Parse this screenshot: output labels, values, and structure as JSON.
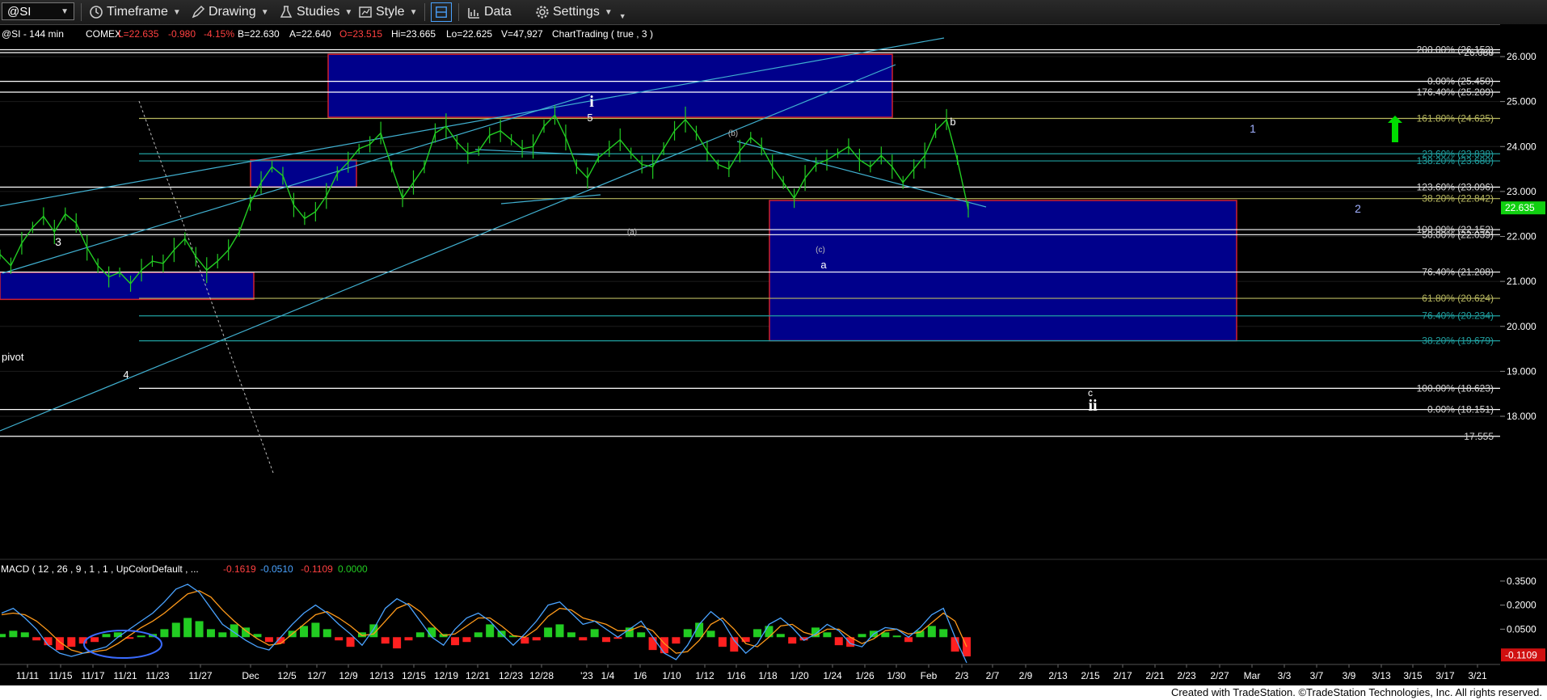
{
  "toolbar": {
    "symbol": "@SI",
    "timeframe": "Timeframe",
    "drawing": "Drawing",
    "studies": "Studies",
    "style": "Style",
    "data": "Data",
    "settings": "Settings"
  },
  "header_line": {
    "symbol": "@SI - 144 min",
    "exchange": "COMEX",
    "last": "L=22.635",
    "change": "-0.980",
    "pct": "-4.15%",
    "bid": "B=22.630",
    "ask": "A=22.640",
    "open": "O=23.515",
    "high": "Hi=23.665",
    "low": "Lo=22.625",
    "volume": "V=47,927",
    "study": "ChartTrading ( true , 3 )"
  },
  "colors": {
    "up": "#22cc22",
    "down": "#ff2020",
    "accent_box": "#00008b",
    "trendline": "#40b0d0",
    "price_tag": "#10d010",
    "macd_tag": "#d01010"
  },
  "chart_data": {
    "type": "line",
    "title": "@SI - 144 min",
    "ylim": [
      17.2,
      26.4
    ],
    "y_ticks": [
      18.0,
      19.0,
      20.0,
      21.0,
      22.0,
      23.0,
      24.0,
      25.0,
      26.0
    ],
    "y_tick_labels": [
      "18.000",
      "19.000",
      "20.000",
      "21.000",
      "22.000",
      "23.000",
      "24.000",
      "25.000",
      "26.000"
    ],
    "last_price_label": "22.635",
    "x_tick_labels": [
      "11/11",
      "11/15",
      "11/17",
      "11/21",
      "11/23",
      "11/27",
      "Dec",
      "12/5",
      "12/7",
      "12/9",
      "12/13",
      "12/15",
      "12/19",
      "12/21",
      "12/23",
      "12/28",
      "'23",
      "1/4",
      "1/6",
      "1/10",
      "1/12",
      "1/16",
      "1/18",
      "1/20",
      "1/24",
      "1/26",
      "1/30",
      "Feb",
      "2/3",
      "2/7",
      "2/9",
      "2/13",
      "2/15",
      "2/17",
      "2/21",
      "2/23",
      "2/27",
      "Mar",
      "3/3",
      "3/7",
      "3/9",
      "3/13",
      "3/15",
      "3/17",
      "3/21"
    ],
    "series": [
      {
        "values": [
          21.6,
          21.35,
          21.85,
          22.2,
          22.45,
          22.1,
          22.5,
          22.3,
          21.75,
          21.35,
          21.1,
          21.2,
          20.95,
          21.25,
          21.45,
          21.4,
          21.7,
          21.95,
          21.55,
          21.25,
          21.45,
          21.7,
          22.1,
          22.75,
          23.2,
          23.55,
          23.35,
          22.7,
          22.4,
          22.55,
          22.9,
          23.4,
          23.65,
          23.95,
          24.05,
          24.3,
          23.55,
          22.85,
          23.2,
          23.55,
          24.3,
          24.45,
          24.1,
          23.85,
          23.9,
          24.25,
          24.35,
          24.15,
          23.95,
          24.0,
          24.45,
          24.7,
          24.2,
          23.55,
          23.3,
          23.75,
          23.95,
          24.15,
          23.85,
          23.6,
          23.55,
          23.95,
          24.35,
          24.6,
          24.3,
          23.9,
          23.6,
          23.5,
          23.9,
          24.2,
          24.0,
          23.55,
          23.2,
          22.85,
          23.3,
          23.6,
          23.7,
          23.85,
          24.0,
          23.7,
          23.55,
          23.8,
          23.55,
          23.2,
          23.5,
          23.8,
          24.35,
          24.6,
          23.7,
          22.6
        ]
      }
    ],
    "boxes": [
      {
        "top": 26.05,
        "bottom": 24.65
      },
      {
        "top": 23.7,
        "bottom": 23.1
      },
      {
        "top": 21.2,
        "bottom": 20.6
      },
      {
        "top": 22.8,
        "bottom": 19.68
      }
    ],
    "fib_levels": [
      {
        "label": "200.00% (26.153)",
        "value": 26.153,
        "color": "#ffffff"
      },
      {
        "label": "26.088",
        "value": 26.088,
        "color": "#ffffff"
      },
      {
        "label": "0.00% (25.450)",
        "value": 25.45,
        "color": "#ffffff"
      },
      {
        "label": "176.40% (25.209)",
        "value": 25.209,
        "color": "#ffffff"
      },
      {
        "label": "161.80% (24.625)",
        "value": 24.625,
        "color": "#b8b860"
      },
      {
        "label": "23.60% (23.838)",
        "value": 23.838,
        "color": "#20a0a0"
      },
      {
        "label": "138.20% (23.680)",
        "value": 23.68,
        "color": "#20a0a0"
      },
      {
        "label": "123.60% (23.096)",
        "value": 23.096,
        "color": "#ffffff"
      },
      {
        "label": "38.20% (22.842)",
        "value": 22.842,
        "color": "#b8b860"
      },
      {
        "label": "100.00% (22.152)",
        "value": 22.152,
        "color": "#ffffff"
      },
      {
        "label": "50.00% (22.039)",
        "value": 22.039,
        "color": "#ffffff"
      },
      {
        "label": "76.40% (21.208)",
        "value": 21.208,
        "color": "#ffffff"
      },
      {
        "label": "61.80% (20.624)",
        "value": 20.624,
        "color": "#b8b860"
      },
      {
        "label": "76.40% (20.234)",
        "value": 20.234,
        "color": "#20a0a0"
      },
      {
        "label": "38.20% (19.679)",
        "value": 19.679,
        "color": "#20a0a0"
      },
      {
        "label": "100.00% (18.623)",
        "value": 18.623,
        "color": "#ffffff"
      },
      {
        "label": "0.00% (18.151)",
        "value": 18.151,
        "color": "#ffffff"
      },
      {
        "label": "17.555",
        "value": 17.555,
        "color": "#ffffff"
      }
    ],
    "wave_labels": [
      {
        "text": "3",
        "kind": "minor"
      },
      {
        "text": "4",
        "kind": "minor"
      },
      {
        "text": "5",
        "kind": "minor"
      },
      {
        "text": "i",
        "kind": "major"
      },
      {
        "text": "(a)",
        "kind": "tiny"
      },
      {
        "text": "(b)",
        "kind": "tiny"
      },
      {
        "text": "(c)",
        "kind": "tiny"
      },
      {
        "text": "a",
        "kind": "minor"
      },
      {
        "text": "b",
        "kind": "minor"
      },
      {
        "text": "c",
        "kind": "minor"
      },
      {
        "text": "ii",
        "kind": "major"
      },
      {
        "text": "1",
        "kind": "blue"
      },
      {
        "text": "2",
        "kind": "blue"
      },
      {
        "text": "pivot",
        "kind": "minor"
      }
    ]
  },
  "macd": {
    "label": "MACD ( 12 , 26 , 9 , 1 , 1 , UpColorDefault , ...",
    "value1": "-0.1619",
    "value2": "-0.0510",
    "value3": "-0.1109",
    "value4": "0.0000",
    "ylim": [
      -0.16,
      0.42
    ],
    "y_ticks": [
      0.35,
      0.2,
      0.05
    ],
    "y_tick_labels": [
      "0.3500",
      "0.2000",
      "0.0500"
    ],
    "last_label": "-0.1109",
    "hist": [
      0.02,
      0.04,
      0.03,
      -0.02,
      -0.05,
      -0.08,
      -0.06,
      -0.04,
      -0.03,
      0.02,
      0.03,
      -0.01,
      0.01,
      0.02,
      0.05,
      0.09,
      0.12,
      0.1,
      0.05,
      0.03,
      0.08,
      0.06,
      0.02,
      -0.03,
      -0.04,
      0.04,
      0.07,
      0.09,
      0.05,
      -0.02,
      -0.06,
      0.03,
      0.08,
      -0.04,
      -0.07,
      -0.02,
      0.03,
      0.06,
      0.02,
      -0.05,
      -0.03,
      0.03,
      0.08,
      0.04,
      0.01,
      -0.04,
      -0.02,
      0.06,
      0.08,
      0.03,
      -0.02,
      0.05,
      -0.03,
      -0.01,
      0.06,
      0.03,
      -0.08,
      -0.1,
      -0.04,
      0.05,
      0.09,
      0.04,
      -0.06,
      -0.09,
      -0.03,
      0.05,
      0.07,
      0.02,
      -0.04,
      -0.02,
      0.06,
      0.03,
      -0.05,
      -0.06,
      0.02,
      0.04,
      0.03,
      0.01,
      -0.03,
      0.04,
      0.07,
      0.05,
      -0.09,
      -0.12
    ],
    "macd_line": [
      0.15,
      0.18,
      0.12,
      0.05,
      -0.05,
      -0.1,
      -0.12,
      -0.1,
      -0.08,
      -0.06,
      0.0,
      0.05,
      0.1,
      0.15,
      0.22,
      0.3,
      0.33,
      0.28,
      0.18,
      0.08,
      0.03,
      -0.02,
      -0.06,
      -0.08,
      0.0,
      0.08,
      0.15,
      0.2,
      0.15,
      0.08,
      0.02,
      -0.05,
      0.05,
      0.18,
      0.24,
      0.2,
      0.1,
      0.0,
      -0.05,
      0.05,
      0.12,
      0.15,
      0.1,
      0.02,
      -0.05,
      0.02,
      0.1,
      0.2,
      0.22,
      0.15,
      0.08,
      0.1,
      0.05,
      0.0,
      0.05,
      0.1,
      0.0,
      -0.1,
      -0.14,
      -0.05,
      0.08,
      0.16,
      0.1,
      -0.02,
      -0.1,
      -0.04,
      0.08,
      0.12,
      0.06,
      -0.02,
      0.02,
      0.08,
      0.04,
      -0.04,
      -0.06,
      0.02,
      0.06,
      0.05,
      0.0,
      0.06,
      0.14,
      0.18,
      0.0,
      -0.16
    ],
    "signal_line": [
      0.14,
      0.15,
      0.14,
      0.1,
      0.04,
      -0.03,
      -0.08,
      -0.1,
      -0.09,
      -0.08,
      -0.04,
      0.01,
      0.06,
      0.1,
      0.15,
      0.21,
      0.27,
      0.29,
      0.25,
      0.17,
      0.1,
      0.04,
      -0.01,
      -0.05,
      -0.04,
      0.02,
      0.08,
      0.14,
      0.16,
      0.12,
      0.07,
      0.01,
      0.02,
      0.1,
      0.18,
      0.21,
      0.16,
      0.08,
      0.01,
      0.02,
      0.07,
      0.12,
      0.12,
      0.07,
      0.01,
      0.0,
      0.05,
      0.13,
      0.18,
      0.17,
      0.12,
      0.1,
      0.08,
      0.04,
      0.04,
      0.07,
      0.04,
      -0.04,
      -0.1,
      -0.09,
      -0.02,
      0.08,
      0.12,
      0.05,
      -0.04,
      -0.06,
      0.0,
      0.07,
      0.08,
      0.03,
      0.01,
      0.05,
      0.05,
      0.0,
      -0.04,
      -0.01,
      0.04,
      0.05,
      0.02,
      0.03,
      0.09,
      0.15,
      0.1,
      -0.06
    ]
  },
  "footer": {
    "credit": "Created with TradeStation. ©TradeStation Technologies, Inc. All rights reserved."
  }
}
